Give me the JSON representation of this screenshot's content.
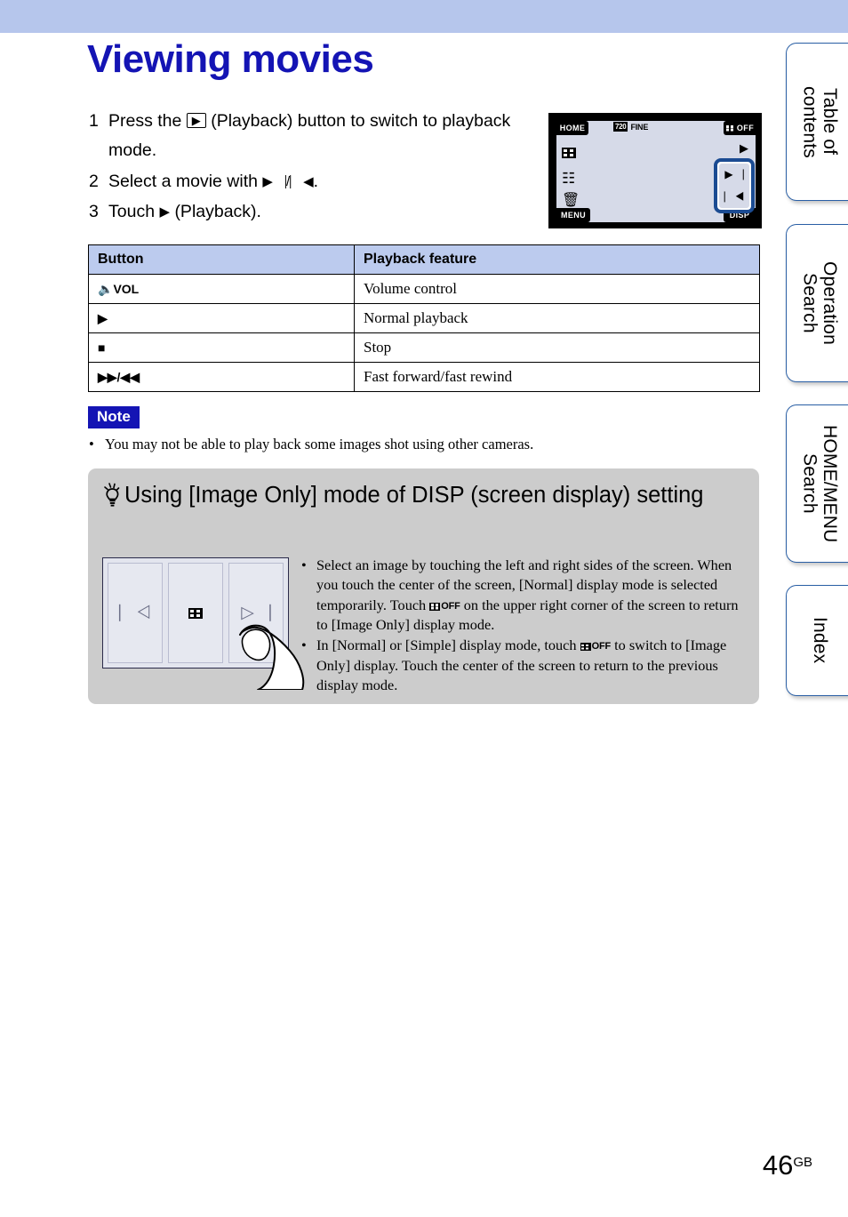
{
  "page": {
    "title": "Viewing movies",
    "number": "46",
    "number_suffix": "GB",
    "title_color": "#1414b4",
    "banner_color": "#b6c6ec"
  },
  "steps": [
    {
      "num": "1",
      "pre": "Press the",
      "icon": "playback-button-icon",
      "icon_glyph": "▶",
      "post": "(Playback) button to switch to playback mode."
    },
    {
      "num": "2",
      "pre": "Select a movie with",
      "icon": "next-prev-icon",
      "icon_glyph": "▶⎹/⎸◀",
      "post": "."
    },
    {
      "num": "3",
      "pre": "Touch",
      "icon": "play-icon",
      "icon_glyph": "▶",
      "post": "(Playback)."
    }
  ],
  "lcd": {
    "home_label": "HOME",
    "menu_label": "MENU",
    "disp_label": "DISP",
    "off_label": "OFF",
    "resolution_badge": "720",
    "quality_label": "FINE",
    "side_icons": [
      "index-view-icon",
      "slideshow-icon",
      "delete-icon"
    ],
    "play_icon": "play-triangle-icon",
    "next_icon": "▶⎹",
    "prev_icon": "⎸◀",
    "highlight_color": "#1b4b92",
    "screen_color": "#d6dae8"
  },
  "table": {
    "headers": [
      "Button",
      "Playback feature"
    ],
    "rows": [
      {
        "button_icon": "volume-icon",
        "button_label": "VOL",
        "feature": "Volume control"
      },
      {
        "button_icon": "play-icon",
        "button_label": "▶",
        "feature": "Normal playback"
      },
      {
        "button_icon": "stop-icon",
        "button_label": "■",
        "feature": "Stop"
      },
      {
        "button_icon": "fast-forward-rewind-icon",
        "button_label": "▶▶/◀◀",
        "feature": "Fast forward/fast rewind"
      }
    ],
    "header_color": "#bccbee"
  },
  "note": {
    "label": "Note",
    "bullet": "•",
    "text": "You may not be able to play back some images shot using other cameras."
  },
  "tip": {
    "heading": "Using [Image Only] mode of DISP (screen display) setting",
    "icon": "lightbulb-icon",
    "background_color": "#cccccc",
    "illustration": {
      "pane_left_icon": "⎸◁",
      "pane_center_icon": "grid-display-icon",
      "pane_right_icon": "▷⎹",
      "finger": "touching-finger-illustration"
    },
    "bullets": [
      {
        "part1": "Select an image by touching the left and right sides of the screen. When you touch the center of the screen, [Normal] display mode is selected temporarily. Touch",
        "icon_label": "OFF",
        "part2": "on the upper right corner of the screen to return to [Image Only] display mode."
      },
      {
        "part1": "In [Normal] or [Simple] display mode, touch",
        "icon_label": "OFF",
        "part2": "to switch to [Image Only] display. Touch the center of the screen to return to the previous display mode."
      }
    ]
  },
  "tabs": [
    {
      "label": "Table of\ncontents"
    },
    {
      "label": "Operation\nSearch"
    },
    {
      "label": "HOME/MENU\nSearch"
    },
    {
      "label": "Index"
    }
  ]
}
